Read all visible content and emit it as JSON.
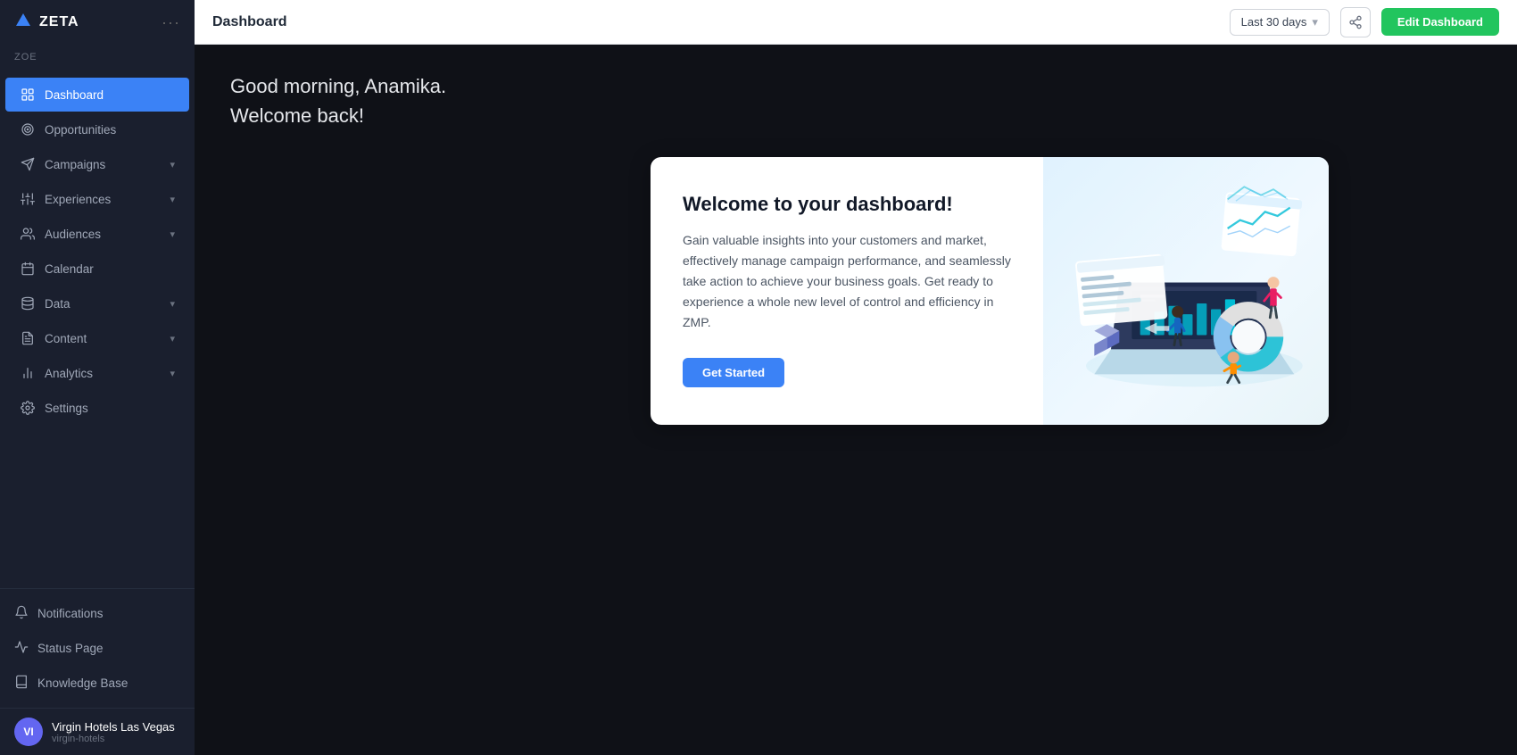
{
  "app": {
    "logo": "ZETA",
    "logo_icon": "zeta-logo"
  },
  "sidebar": {
    "user_section_label": "ZOE",
    "dots_label": "···",
    "nav_items": [
      {
        "id": "dashboard",
        "label": "Dashboard",
        "icon": "grid-icon",
        "active": true,
        "has_chevron": false
      },
      {
        "id": "opportunities",
        "label": "Opportunities",
        "icon": "target-icon",
        "active": false,
        "has_chevron": false
      },
      {
        "id": "campaigns",
        "label": "Campaigns",
        "icon": "send-icon",
        "active": false,
        "has_chevron": true
      },
      {
        "id": "experiences",
        "label": "Experiences",
        "icon": "sliders-icon",
        "active": false,
        "has_chevron": true
      },
      {
        "id": "audiences",
        "label": "Audiences",
        "icon": "users-icon",
        "active": false,
        "has_chevron": true
      },
      {
        "id": "calendar",
        "label": "Calendar",
        "icon": "calendar-icon",
        "active": false,
        "has_chevron": false
      },
      {
        "id": "data",
        "label": "Data",
        "icon": "database-icon",
        "active": false,
        "has_chevron": true
      },
      {
        "id": "content",
        "label": "Content",
        "icon": "file-icon",
        "active": false,
        "has_chevron": true
      },
      {
        "id": "analytics",
        "label": "Analytics",
        "icon": "bar-chart-icon",
        "active": false,
        "has_chevron": true
      },
      {
        "id": "settings",
        "label": "Settings",
        "icon": "settings-icon",
        "active": false,
        "has_chevron": false
      }
    ],
    "bottom_items": [
      {
        "id": "notifications",
        "label": "Notifications",
        "icon": "bell-icon"
      },
      {
        "id": "status-page",
        "label": "Status Page",
        "icon": "activity-icon"
      },
      {
        "id": "knowledge-base",
        "label": "Knowledge Base",
        "icon": "book-icon"
      }
    ],
    "account": {
      "avatar_initials": "VI",
      "name": "Virgin Hotels Las Vegas",
      "subdomain": "virgin-hotels"
    }
  },
  "topbar": {
    "title": "Dashboard",
    "date_range": "Last 30 days",
    "share_tooltip": "Share",
    "edit_button_label": "Edit Dashboard"
  },
  "content": {
    "greeting_line1": "Good morning, Anamika.",
    "greeting_line2": "Welcome back!",
    "welcome_card": {
      "title": "Welcome to your dashboard!",
      "description": "Gain valuable insights into your customers and market, effectively manage campaign performance, and seamlessly take action to achieve your business goals. Get ready to experience a whole new level of control and efficiency in ZMP.",
      "cta_label": "Get Started"
    }
  }
}
